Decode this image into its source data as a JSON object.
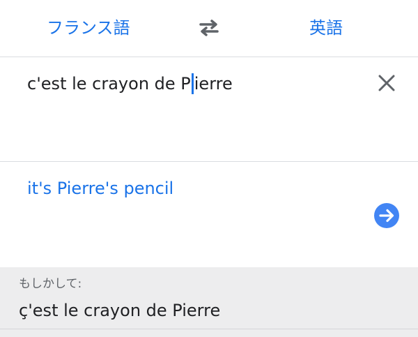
{
  "languages": {
    "source": "フランス語",
    "target": "英語"
  },
  "input": {
    "before_caret": "c'est le crayon de P",
    "after_caret": "ierre"
  },
  "output": {
    "translation": "it's Pierre's pencil"
  },
  "suggestion": {
    "label": "もしかして:",
    "text": "ç'est le crayon de Pierre"
  },
  "icons": {
    "swap": "swap-arrows-icon",
    "clear": "close-icon",
    "go": "arrow-right-circle-icon"
  },
  "colors": {
    "accent": "#1a73e8",
    "text": "#202124",
    "muted": "#5f6368",
    "suggestion_bg": "#ededee"
  }
}
